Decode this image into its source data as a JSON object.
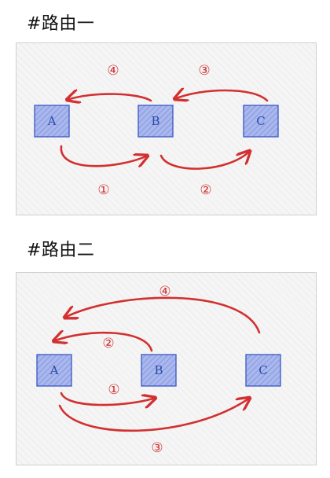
{
  "sections": [
    {
      "title": "#路由一",
      "nodes": [
        "A",
        "B",
        "C"
      ],
      "steps": [
        "①",
        "②",
        "③",
        "④"
      ]
    },
    {
      "title": "#路由二",
      "nodes": [
        "A",
        "B",
        "C"
      ],
      "steps": [
        "①",
        "②",
        "③",
        "④"
      ]
    }
  ],
  "colors": {
    "node_fill": "#a9b7ec",
    "node_border": "#3a57c4",
    "arrow": "#d23030",
    "panel_bg": "#f5f5f5",
    "panel_border": "#cfcfcf"
  }
}
